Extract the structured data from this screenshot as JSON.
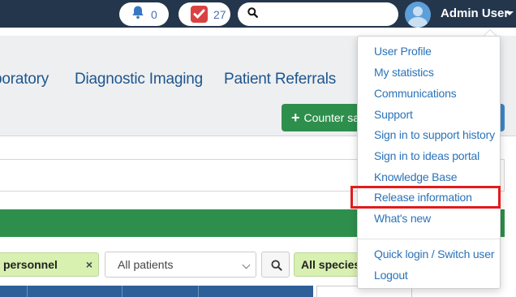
{
  "header": {
    "notifications_count": "0",
    "tasks_count": "27",
    "search_placeholder": "",
    "user_name": "Admin User"
  },
  "nav": {
    "tabs": [
      {
        "label": "boratory"
      },
      {
        "label": "Diagnostic Imaging"
      },
      {
        "label": "Patient Referrals"
      }
    ],
    "counter_sale_label": "Counter sale"
  },
  "filters": {
    "personnel_chip": "personnel",
    "patients_select": "All patients",
    "species_chip": "All species"
  },
  "user_menu": {
    "items": [
      {
        "label": "User Profile"
      },
      {
        "label": "My statistics"
      },
      {
        "label": "Communications"
      },
      {
        "label": "Support"
      },
      {
        "label": "Sign in to support history"
      },
      {
        "label": "Sign in to ideas portal"
      },
      {
        "label": "Knowledge Base"
      },
      {
        "label": "Release information",
        "highlighted": true
      },
      {
        "label": "What's new"
      },
      {
        "label": "Quick login / Switch user"
      },
      {
        "label": "Logout"
      }
    ]
  },
  "colors": {
    "topbar": "#24364c",
    "link": "#2a73b8",
    "green": "#2e8f4d",
    "highlight_border": "#e31b1b"
  }
}
